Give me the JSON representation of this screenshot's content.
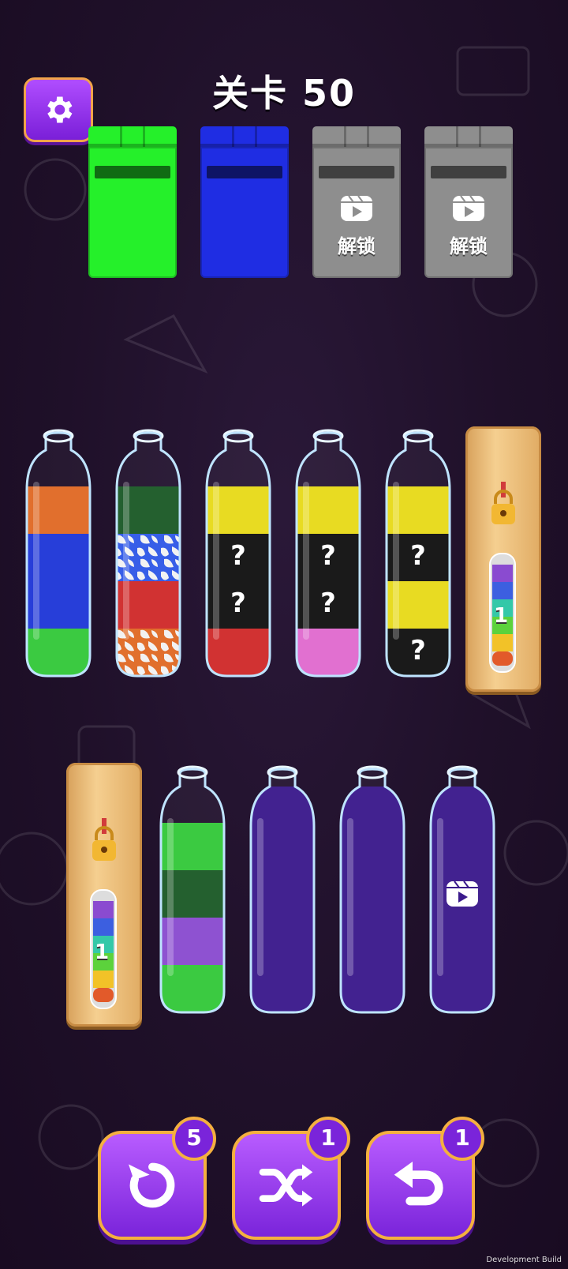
{
  "level": {
    "title": "关卡 50"
  },
  "top_boxes": [
    {
      "color": "#25f02a",
      "locked": false,
      "label": ""
    },
    {
      "color": "#1f2de3",
      "locked": false,
      "label": ""
    },
    {
      "color": "#8e8e8e",
      "locked": true,
      "label": "解锁"
    },
    {
      "color": "#8e8e8e",
      "locked": true,
      "label": "解锁"
    }
  ],
  "tubes_row1": [
    {
      "layers": [
        "#e06a25",
        "#1f37d8",
        "#1f37d8",
        "#34c83a"
      ]
    },
    {
      "layers": [
        "#1c5a27",
        "camo-blue",
        "#d02a2a",
        "camo-orange"
      ]
    },
    {
      "layers": [
        "#e8da19",
        "hidden",
        "hidden",
        "#d02a2a"
      ]
    },
    {
      "layers": [
        "#e8da19",
        "hidden",
        "hidden",
        "#e06bcf"
      ]
    },
    {
      "layers": [
        "#e8da19",
        "hidden",
        "#e8da19",
        "hidden"
      ]
    }
  ],
  "tubes_row2": [
    {
      "layers": [
        "#34c83a",
        "#1c5a27",
        "#8a4bd0",
        "#34c83a"
      ]
    },
    {
      "layers": []
    },
    {
      "layers": []
    },
    {
      "layers": [],
      "video_unlock": true
    }
  ],
  "hidden_mark": "?",
  "locked_tube_count": "1",
  "buttons": {
    "restart": {
      "count": "5"
    },
    "shuffle": {
      "count": "1"
    },
    "undo": {
      "count": "1"
    }
  },
  "footer": "Development Build",
  "colors": {
    "accent": "#9b3df5",
    "button_border": "#f4b03f",
    "background": "#1f1029"
  }
}
